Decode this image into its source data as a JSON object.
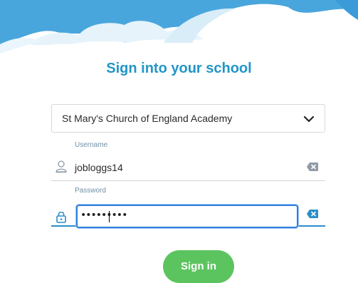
{
  "heading": "Sign into your school",
  "school_select": {
    "selected": "St Mary's Church of England Academy",
    "chevron_icon": "chevron-down-icon"
  },
  "username": {
    "label": "Username",
    "value": "jobloggs14",
    "icon": "user-icon",
    "clear_icon": "clear-text-icon"
  },
  "password": {
    "label": "Password",
    "masked_value": "•••••••••",
    "icon": "lock-icon",
    "clear_icon": "clear-text-icon"
  },
  "signin_label": "Sign in",
  "colors": {
    "accent": "#2196c8",
    "focus": "#2f7fdd",
    "signin": "#5cc45f",
    "cloud": "#4aa6dd"
  }
}
